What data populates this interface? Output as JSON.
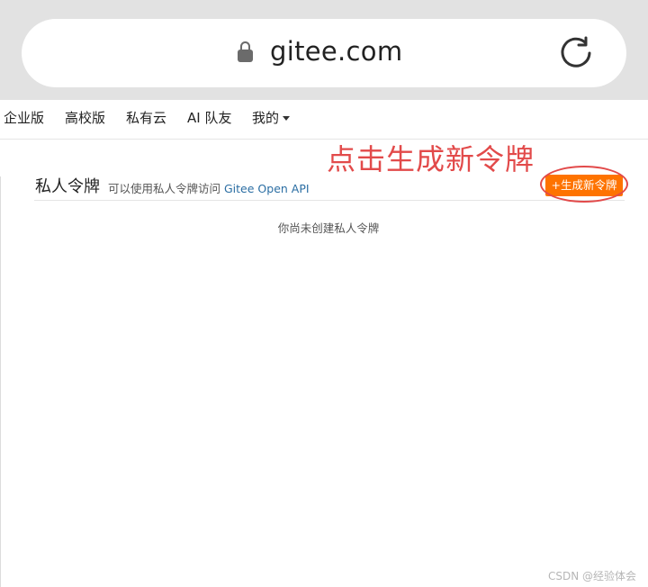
{
  "browser": {
    "url": "gitee.com",
    "icons": {
      "lock": "lock-icon",
      "reload": "reload-icon"
    }
  },
  "nav": {
    "items": [
      {
        "label": "企业版"
      },
      {
        "label": "高校版"
      },
      {
        "label": "私有云"
      },
      {
        "label": "AI 队友"
      },
      {
        "label": "我的"
      }
    ],
    "dropdown_icon": "caret-down-icon"
  },
  "annotation": {
    "text": "点击生成新令牌",
    "color": "#e24a4a"
  },
  "tokens_section": {
    "title": "私人令牌",
    "description_prefix": "可以使用私人令牌访问",
    "api_link": "Gitee Open API",
    "new_button_label": "+生成新令牌",
    "empty_message": "你尚未创建私人令牌",
    "button_color": "#fe7300"
  },
  "watermark": "CSDN @经验体会"
}
